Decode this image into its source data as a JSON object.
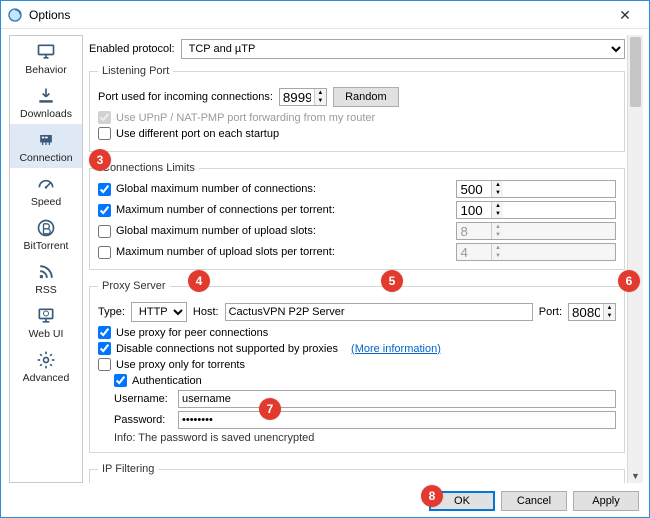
{
  "window": {
    "title": "Options"
  },
  "sidebar": {
    "items": [
      {
        "label": "Behavior"
      },
      {
        "label": "Downloads"
      },
      {
        "label": "Connection"
      },
      {
        "label": "Speed"
      },
      {
        "label": "BitTorrent"
      },
      {
        "label": "RSS"
      },
      {
        "label": "Web UI"
      },
      {
        "label": "Advanced"
      }
    ]
  },
  "protocol": {
    "label": "Enabled protocol:",
    "value": "TCP and µTP"
  },
  "listening": {
    "legend": "Listening Port",
    "port_label": "Port used for incoming connections:",
    "port_value": "8999",
    "random": "Random",
    "upnp": "Use UPnP / NAT-PMP port forwarding from my router",
    "diff_port": "Use different port on each startup"
  },
  "limits": {
    "legend": "Connections Limits",
    "global_max": "Global maximum number of connections:",
    "global_max_val": "500",
    "per_torrent": "Maximum number of connections per torrent:",
    "per_torrent_val": "100",
    "upload_slots": "Global maximum number of upload slots:",
    "upload_slots_val": "8",
    "upload_slots_per": "Maximum number of upload slots per torrent:",
    "upload_slots_per_val": "4"
  },
  "proxy": {
    "legend": "Proxy Server",
    "type_label": "Type:",
    "type_value": "HTTP",
    "host_label": "Host:",
    "host_value": "CactusVPN P2P Server",
    "port_label": "Port:",
    "port_value": "8080",
    "peer": "Use proxy for peer connections",
    "disable_unsupported": "Disable connections not supported by proxies",
    "more_info": "(More information)",
    "only_torrents": "Use proxy only for torrents",
    "auth": "Authentication",
    "user_label": "Username:",
    "user_value": "username",
    "pass_label": "Password:",
    "pass_value": "••••••••",
    "info": "Info: The password is saved unencrypted"
  },
  "ipfilter": {
    "legend": "IP Filtering"
  },
  "footer": {
    "ok": "OK",
    "cancel": "Cancel",
    "apply": "Apply"
  },
  "badges": {
    "b3": "3",
    "b4": "4",
    "b5": "5",
    "b6": "6",
    "b7": "7",
    "b8": "8"
  }
}
